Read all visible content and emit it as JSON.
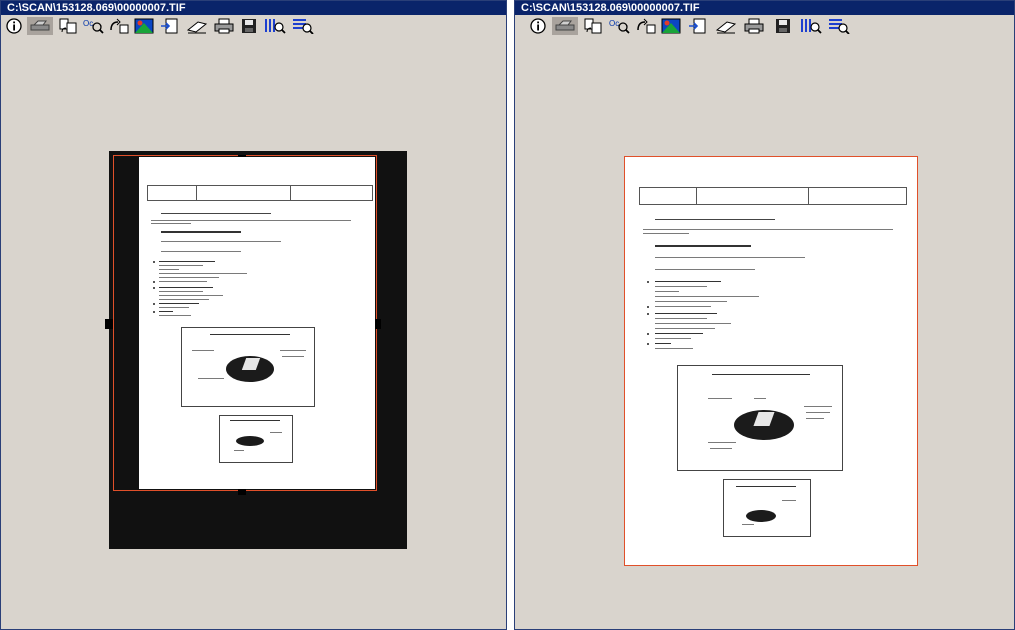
{
  "windows": [
    {
      "title": "C:\\SCAN\\153128.069\\00000007.TIF",
      "toolbar": [
        "info-icon",
        "scan-icon",
        "rotate-pages-icon",
        "ocr-zoom-icon",
        "rotate-icon",
        "color-picture-icon",
        "insert-page-icon",
        "erase-icon",
        "print-icon",
        "save-icon",
        "zoom-columns-icon",
        "zoom-lines-icon"
      ]
    },
    {
      "title": "C:\\SCAN\\153128.069\\00000007.TIF",
      "toolbar": [
        "info-icon",
        "scan-icon",
        "rotate-pages-icon",
        "ocr-zoom-icon",
        "rotate-icon",
        "color-picture-icon",
        "insert-page-icon",
        "erase-icon",
        "print-icon",
        "save-icon",
        "zoom-columns-icon",
        "zoom-lines-icon"
      ]
    }
  ],
  "colors": {
    "title_bar": "#0a246a",
    "window_background": "#d9d4cd",
    "crop_border": "#e0502a",
    "scan_background": "#111111"
  }
}
